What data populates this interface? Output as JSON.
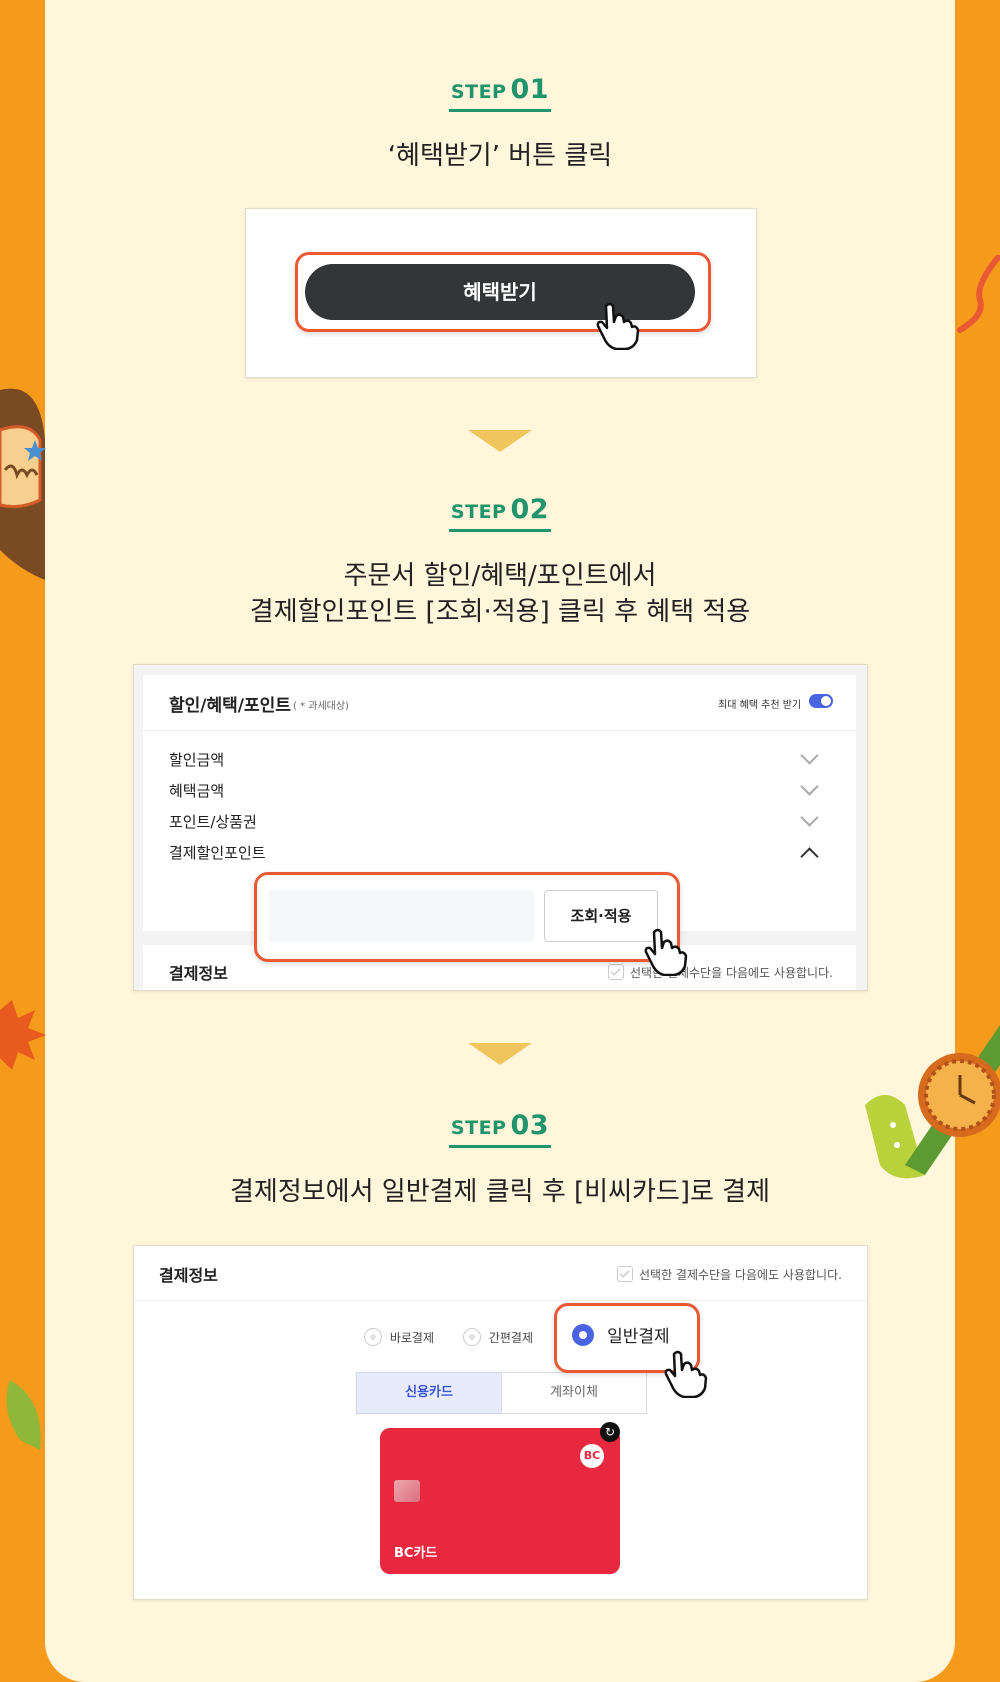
{
  "step1": {
    "word": "STEP",
    "num": "01",
    "desc": "‘혜택받기’ 버튼 클릭",
    "button_label": "혜택받기"
  },
  "step2": {
    "word": "STEP",
    "num": "02",
    "desc_line1": "주문서 할인/혜택/포인트에서",
    "desc_line2": "결제할인포인트 [조회·적용] 클릭 후 혜택 적용",
    "section_title": "할인/혜택/포인트",
    "section_note": "( * 과세대상)",
    "toggle_label": "최대 혜택 추천 받기",
    "items": [
      {
        "label": "할인금액"
      },
      {
        "label": "혜택금액"
      },
      {
        "label": "포인트/상품권"
      },
      {
        "label": "결제할인포인트"
      }
    ],
    "apply_button": "조회·적용",
    "payment_info_title": "결제정보",
    "payment_info_check": "선택한 결제수단을 다음에도 사용합니다."
  },
  "step3": {
    "word": "STEP",
    "num": "03",
    "desc": "결제정보에서 일반결제 클릭 후 [비씨카드]로 결제",
    "panel_title": "결제정보",
    "check_label": "선택한 결제수단을 다음에도 사용합니다.",
    "radio_options": [
      "바로결제",
      "간편결제",
      "일반결제"
    ],
    "tabs": [
      "신용카드",
      "계좌이체"
    ],
    "card_name": "BC카드",
    "card_logo": "BC"
  },
  "colors": {
    "background": "#f59a1b",
    "panel": "#fff6dc",
    "step_green": "#20946a",
    "highlight": "#e95a34",
    "dark_button": "#333536",
    "card_red": "#e8283e",
    "radio_blue": "#4a63e0"
  }
}
